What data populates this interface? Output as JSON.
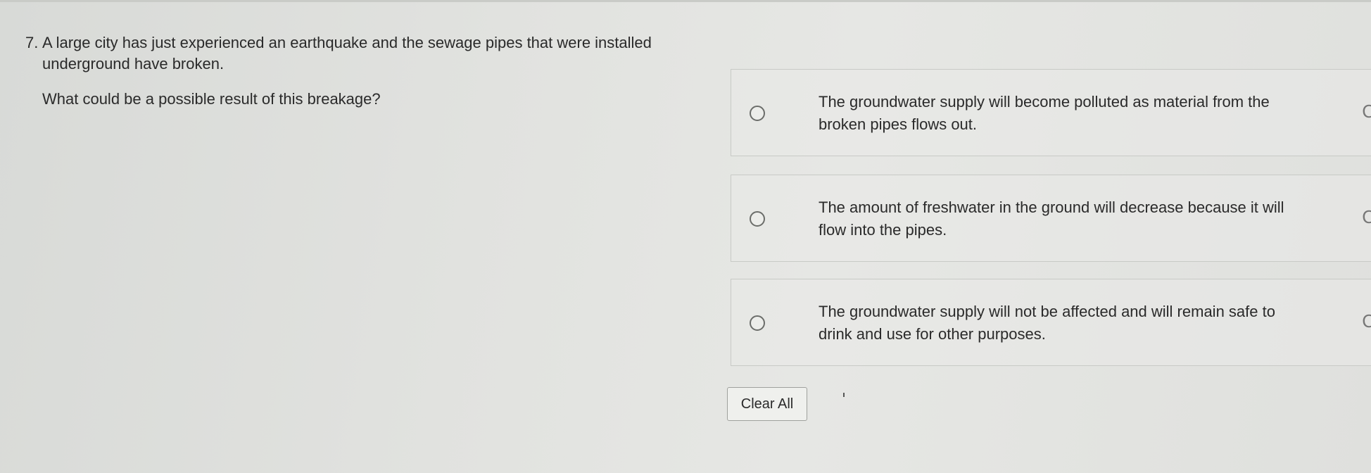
{
  "question": {
    "number": "7.",
    "text": "A large city has just experienced an earthquake and the sewage pipes that were installed underground have broken.",
    "prompt": "What could be a possible result of this breakage?"
  },
  "choices": [
    {
      "text": "The groundwater supply will become polluted as material from the broken pipes flows out.",
      "selected": false,
      "edge_glyph": "C"
    },
    {
      "text": "The amount of freshwater in the ground will decrease because it will flow into the pipes.",
      "selected": false,
      "edge_glyph": "C"
    },
    {
      "text": "The groundwater supply will not be affected and will remain safe to drink and use for other purposes.",
      "selected": false,
      "edge_glyph": "C"
    }
  ],
  "actions": {
    "clear_all_label": "Clear All"
  }
}
